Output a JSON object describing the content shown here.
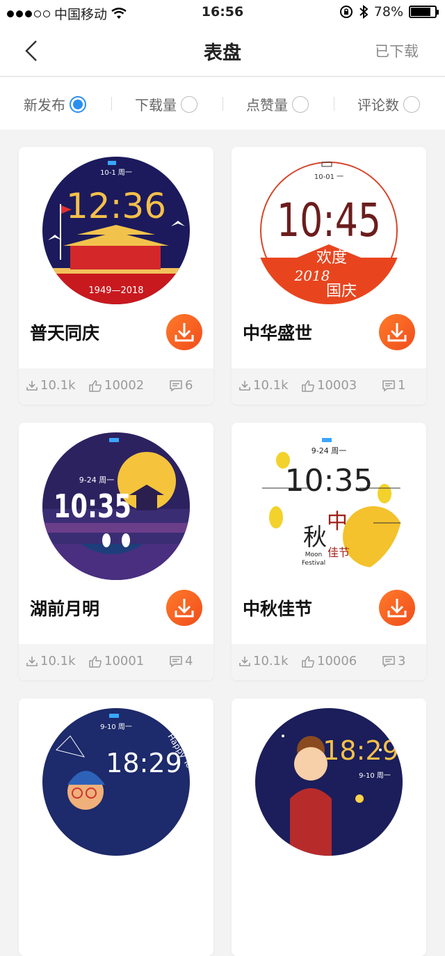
{
  "status_bar": {
    "carrier": "中国移动",
    "time": "16:56",
    "battery": "78%"
  },
  "nav": {
    "title": "表盘",
    "right_label": "已下载"
  },
  "filters": [
    {
      "label": "新发布",
      "selected": true
    },
    {
      "label": "下载量",
      "selected": false
    },
    {
      "label": "点赞量",
      "selected": false
    },
    {
      "label": "评论数",
      "selected": false
    }
  ],
  "cards": [
    {
      "title": "普天同庆",
      "downloads": "10.1k",
      "likes": "10002",
      "comments": "6",
      "face": {
        "date": "10-1 周一",
        "time": "12:36",
        "footer": "1949—2018"
      }
    },
    {
      "title": "中华盛世",
      "downloads": "10.1k",
      "likes": "10003",
      "comments": "1",
      "face": {
        "date": "10-01 一",
        "time": "10:45",
        "line1": "欢度",
        "line2": "2018",
        "line3": "国庆"
      }
    },
    {
      "title": "湖前月明",
      "downloads": "10.1k",
      "likes": "10001",
      "comments": "4",
      "face": {
        "date": "9-24 周一",
        "time": "10:35"
      }
    },
    {
      "title": "中秋佳节",
      "downloads": "10.1k",
      "likes": "10006",
      "comments": "3",
      "face": {
        "date": "9-24 周一",
        "time": "10:35",
        "big1": "秋",
        "big2": "中",
        "big3": "佳节",
        "en1": "Moon",
        "en2": "Festival"
      }
    },
    {
      "title": "",
      "downloads": "",
      "likes": "",
      "comments": "",
      "face": {
        "date": "9-10 周一",
        "time": "18:29",
        "arc": "Happy Teacher's"
      }
    },
    {
      "title": "",
      "downloads": "",
      "likes": "",
      "comments": "",
      "face": {
        "date": "9-10 周一",
        "time": "18:29"
      }
    }
  ],
  "colors": {
    "accent_orange": "#f15a24",
    "selected_blue": "#2b8ef0"
  }
}
